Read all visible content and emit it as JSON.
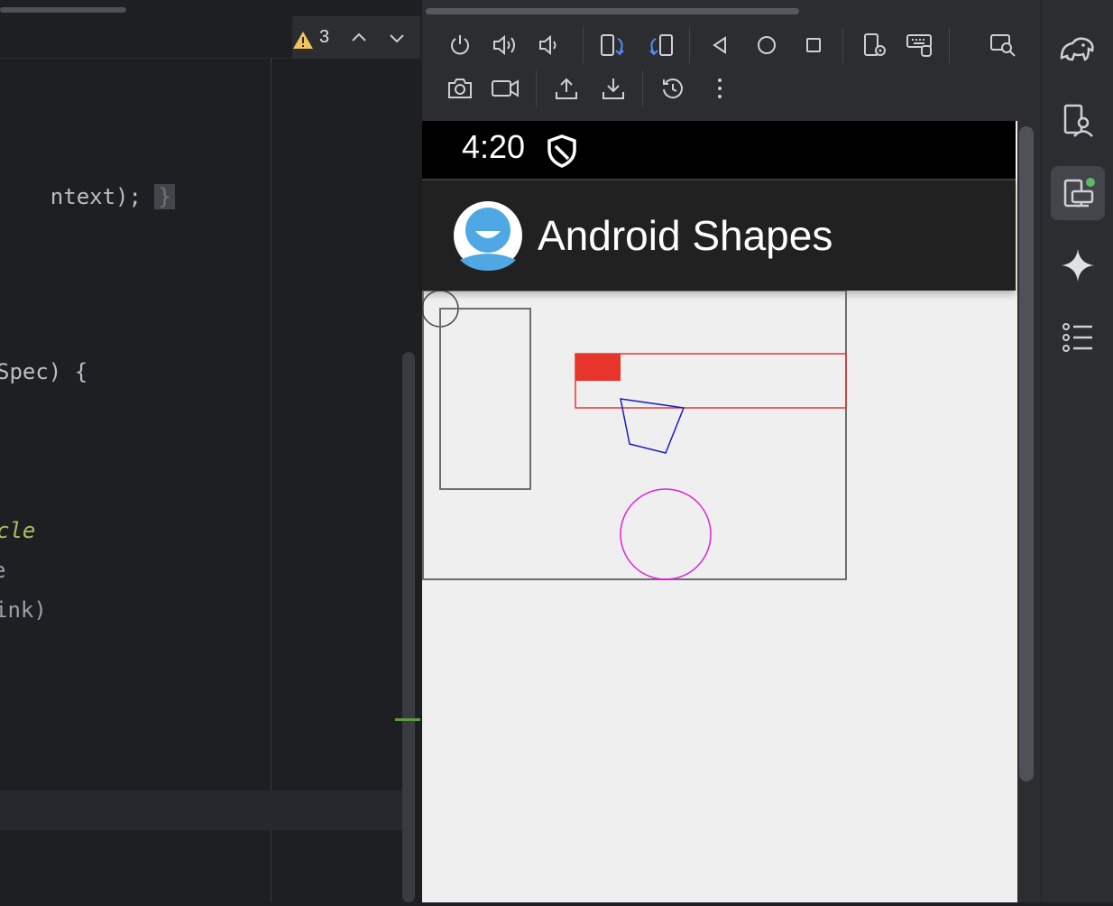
{
  "editor": {
    "inspection": {
      "warning_count": "3"
    },
    "code_lines": [
      {
        "text": "ntext);",
        "trail": "}"
      },
      {
        "text": "Spec) {"
      },
      {
        "text": "cle"
      },
      {
        "text": "e"
      },
      {
        "text": "ink)"
      }
    ]
  },
  "emulator": {
    "toolbar": {
      "row1": [
        "power",
        "volume-up",
        "volume-down",
        "rotate-left",
        "rotate-right",
        "back",
        "home",
        "overview",
        "extended-controls",
        "keyboard",
        "layout-inspector"
      ],
      "row2": [
        "screenshot",
        "screen-record",
        "upload",
        "download",
        "snapshot",
        "more"
      ]
    },
    "device": {
      "status_time": "4:20",
      "app_title": "Android Shapes",
      "drawing": {
        "colors": {
          "frame": "#6e6e6e",
          "red_rect": "#e53935",
          "red_fill": "#e8352b",
          "polygon": "#1a1acc",
          "circle": "#dd22dd"
        }
      }
    }
  },
  "colors": {
    "ide_bg": "#1e1f22",
    "panel_bg": "#2b2d30",
    "accent_blue": "#548af7",
    "warning": "#f2c55c",
    "active_dot": "#5fb865"
  }
}
